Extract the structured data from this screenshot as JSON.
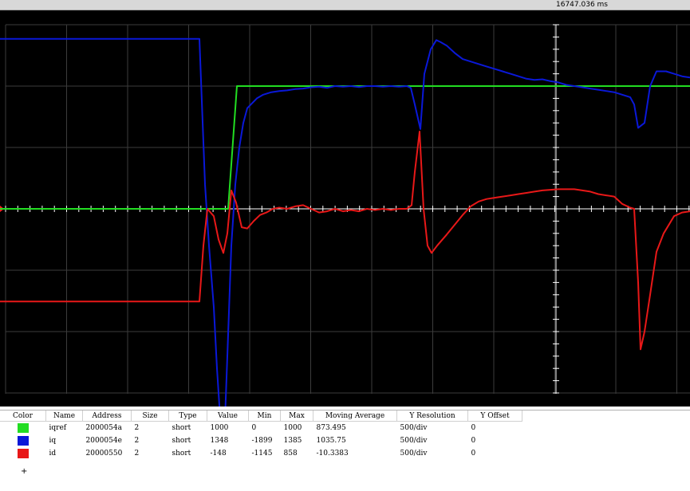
{
  "header": {
    "time": "16747.036 ms"
  },
  "scope": {
    "background": "#000000",
    "grid_color": "#3c3c3c",
    "axis_color": "#ffffff",
    "marker_color": "#ff2020",
    "series": [
      {
        "id": "iqref",
        "color": "#22dd22",
        "points": [
          [
            0,
            0
          ],
          [
            257,
            0
          ],
          [
            286,
            0
          ],
          [
            297,
            1000
          ],
          [
            865,
            1000
          ]
        ]
      },
      {
        "id": "iq",
        "color": "#0a18d8",
        "points": [
          [
            0,
            1385
          ],
          [
            250,
            1385
          ],
          [
            257,
            200
          ],
          [
            262,
            -300
          ],
          [
            268,
            -800
          ],
          [
            272,
            -1300
          ],
          [
            276,
            -1700
          ],
          [
            281,
            -1899
          ],
          [
            285,
            -1200
          ],
          [
            290,
            -300
          ],
          [
            295,
            200
          ],
          [
            300,
            500
          ],
          [
            305,
            700
          ],
          [
            310,
            820
          ],
          [
            316,
            860
          ],
          [
            322,
            900
          ],
          [
            330,
            930
          ],
          [
            340,
            950
          ],
          [
            350,
            960
          ],
          [
            360,
            965
          ],
          [
            370,
            975
          ],
          [
            380,
            980
          ],
          [
            390,
            990
          ],
          [
            400,
            995
          ],
          [
            410,
            985
          ],
          [
            420,
            1000
          ],
          [
            430,
            995
          ],
          [
            440,
            1000
          ],
          [
            450,
            992
          ],
          [
            460,
            1000
          ],
          [
            470,
            1000
          ],
          [
            480,
            995
          ],
          [
            490,
            1000
          ],
          [
            500,
            995
          ],
          [
            510,
            1000
          ],
          [
            515,
            985
          ],
          [
            520,
            850
          ],
          [
            527,
            650
          ],
          [
            532,
            1100
          ],
          [
            540,
            1300
          ],
          [
            547,
            1375
          ],
          [
            552,
            1360
          ],
          [
            560,
            1330
          ],
          [
            570,
            1270
          ],
          [
            580,
            1220
          ],
          [
            590,
            1200
          ],
          [
            600,
            1180
          ],
          [
            610,
            1160
          ],
          [
            620,
            1140
          ],
          [
            630,
            1120
          ],
          [
            640,
            1100
          ],
          [
            650,
            1080
          ],
          [
            660,
            1060
          ],
          [
            670,
            1050
          ],
          [
            680,
            1055
          ],
          [
            690,
            1040
          ],
          [
            700,
            1030
          ],
          [
            710,
            1010
          ],
          [
            720,
            1000
          ],
          [
            730,
            990
          ],
          [
            740,
            980
          ],
          [
            750,
            970
          ],
          [
            760,
            960
          ],
          [
            770,
            950
          ],
          [
            780,
            930
          ],
          [
            790,
            910
          ],
          [
            795,
            850
          ],
          [
            800,
            660
          ],
          [
            808,
            700
          ],
          [
            815,
            1000
          ],
          [
            823,
            1120
          ],
          [
            835,
            1120
          ],
          [
            845,
            1100
          ],
          [
            855,
            1080
          ],
          [
            865,
            1070
          ]
        ]
      },
      {
        "id": "id",
        "color": "#e81818",
        "points": [
          [
            0,
            -755
          ],
          [
            250,
            -755
          ],
          [
            255,
            -300
          ],
          [
            260,
            0
          ],
          [
            268,
            -60
          ],
          [
            274,
            -250
          ],
          [
            280,
            -360
          ],
          [
            285,
            -200
          ],
          [
            290,
            150
          ],
          [
            296,
            50
          ],
          [
            303,
            -150
          ],
          [
            310,
            -160
          ],
          [
            318,
            -100
          ],
          [
            326,
            -50
          ],
          [
            334,
            -30
          ],
          [
            342,
            0
          ],
          [
            350,
            10
          ],
          [
            360,
            0
          ],
          [
            370,
            20
          ],
          [
            380,
            30
          ],
          [
            390,
            0
          ],
          [
            400,
            -30
          ],
          [
            410,
            -20
          ],
          [
            420,
            0
          ],
          [
            430,
            -20
          ],
          [
            440,
            -10
          ],
          [
            450,
            -20
          ],
          [
            460,
            0
          ],
          [
            470,
            -10
          ],
          [
            480,
            0
          ],
          [
            490,
            -10
          ],
          [
            500,
            0
          ],
          [
            510,
            0
          ],
          [
            516,
            30
          ],
          [
            520,
            300
          ],
          [
            526,
            630
          ],
          [
            531,
            0
          ],
          [
            536,
            -300
          ],
          [
            541,
            -360
          ],
          [
            548,
            -300
          ],
          [
            560,
            -210
          ],
          [
            570,
            -130
          ],
          [
            580,
            -50
          ],
          [
            590,
            20
          ],
          [
            600,
            60
          ],
          [
            610,
            80
          ],
          [
            620,
            90
          ],
          [
            630,
            100
          ],
          [
            640,
            110
          ],
          [
            650,
            120
          ],
          [
            660,
            130
          ],
          [
            670,
            140
          ],
          [
            680,
            150
          ],
          [
            690,
            155
          ],
          [
            700,
            160
          ],
          [
            710,
            160
          ],
          [
            720,
            160
          ],
          [
            730,
            150
          ],
          [
            740,
            140
          ],
          [
            750,
            120
          ],
          [
            760,
            110
          ],
          [
            770,
            100
          ],
          [
            780,
            40
          ],
          [
            790,
            10
          ],
          [
            795,
            0
          ],
          [
            800,
            -600
          ],
          [
            803,
            -1145
          ],
          [
            808,
            -1000
          ],
          [
            815,
            -700
          ],
          [
            823,
            -350
          ],
          [
            832,
            -200
          ],
          [
            845,
            -60
          ],
          [
            855,
            -30
          ],
          [
            865,
            -20
          ]
        ]
      }
    ]
  },
  "table": {
    "headers": [
      "Color",
      "Name",
      "Address",
      "Size",
      "Type",
      "Value",
      "Min",
      "Max",
      "Moving Average",
      "Y Resolution",
      "Y Offset"
    ],
    "rows": [
      {
        "color": "#22dd22",
        "name": "iqref",
        "address": "2000054a",
        "size": "2",
        "type": "short",
        "value": "1000",
        "min": "0",
        "max": "1000",
        "avg": "873.495",
        "yres": "500/div",
        "yoff": "0"
      },
      {
        "color": "#0a18d8",
        "name": "iq",
        "address": "2000054e",
        "size": "2",
        "type": "short",
        "value": "1348",
        "min": "-1899",
        "max": "1385",
        "avg": "1035.75",
        "yres": "500/div",
        "yoff": "0"
      },
      {
        "color": "#e81818",
        "name": "id",
        "address": "20000550",
        "size": "2",
        "type": "short",
        "value": "-148",
        "min": "-1145",
        "max": "858",
        "avg": "-10.3383",
        "yres": "500/div",
        "yoff": "0"
      }
    ],
    "add_label": "+"
  }
}
